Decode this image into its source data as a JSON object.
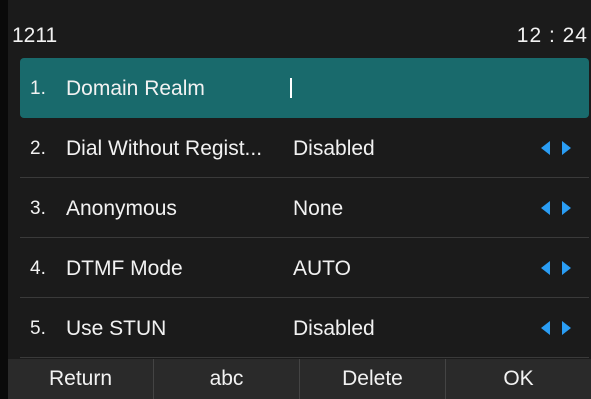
{
  "status_bar": {
    "account": "1211",
    "time": "12 : 24"
  },
  "rows": [
    {
      "index": "1.",
      "label": "Domain Realm",
      "value": "",
      "selected": true
    },
    {
      "index": "2.",
      "label": "Dial Without Regist...",
      "value": "Disabled",
      "selected": false
    },
    {
      "index": "3.",
      "label": "Anonymous",
      "value": "None",
      "selected": false
    },
    {
      "index": "4.",
      "label": "DTMF Mode",
      "value": "AUTO",
      "selected": false
    },
    {
      "index": "5.",
      "label": "Use STUN",
      "value": "Disabled",
      "selected": false
    }
  ],
  "softkeys": {
    "return_label": "Return",
    "abc_label": "abc",
    "delete_label": "Delete",
    "ok_label": "OK"
  },
  "colors": {
    "selection": "#196a6c",
    "arrow": "#2a9df4",
    "background": "#1b1b1b",
    "softkey_bar": "#2a2a2a"
  },
  "icons": {
    "switch_arrows": "left-right-arrows-icon"
  }
}
